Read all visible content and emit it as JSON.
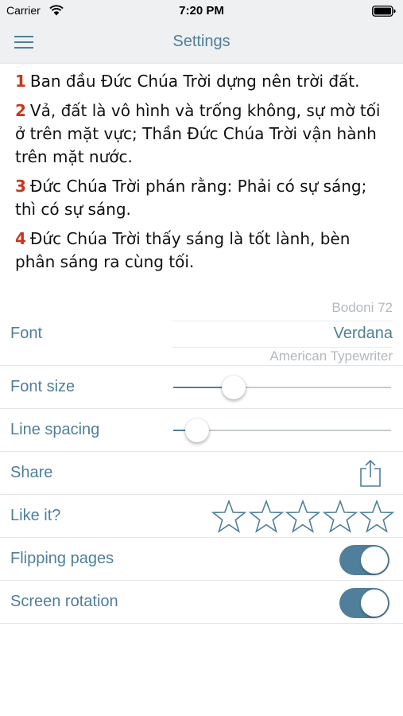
{
  "status_bar": {
    "carrier": "Carrier",
    "time": "7:20 PM"
  },
  "nav": {
    "title": "Settings",
    "menu_icon": "menu-icon"
  },
  "preview": {
    "verses": [
      {
        "num": "1",
        "text": "Ban đầu Đức Chúa Trời dựng nên trời đất."
      },
      {
        "num": "2",
        "text": "Vả, đất là vô hình và trống không, sự mờ tối ở trên mặt vực; Thần Đức Chúa Trời vận hành trên mặt nước."
      },
      {
        "num": "3",
        "text": "Đức Chúa Trời phán rằng: Phải có sự sáng; thì có sự sáng."
      },
      {
        "num": "4",
        "text": "Đức Chúa Trời thấy sáng là tốt lành, bèn phân sáng ra cùng tối."
      }
    ]
  },
  "settings": {
    "font": {
      "label": "Font",
      "options": [
        "Bodoni 72",
        "Verdana",
        "American Typewriter"
      ],
      "selected": "Verdana"
    },
    "font_size": {
      "label": "Font size",
      "value": 0.25
    },
    "line_spacing": {
      "label": "Line spacing",
      "value": 0.06
    },
    "share": {
      "label": "Share",
      "icon": "share-icon"
    },
    "like": {
      "label": "Like it?",
      "stars_total": 5,
      "stars_filled": 0,
      "icon": "star-icon"
    },
    "flipping_pages": {
      "label": "Flipping pages",
      "enabled": true
    },
    "screen_rotation": {
      "label": "Screen rotation",
      "enabled": true
    }
  },
  "colors": {
    "accent": "#4f7f9a",
    "verse_number": "#c8381f",
    "bar_background": "#eef0f1"
  }
}
